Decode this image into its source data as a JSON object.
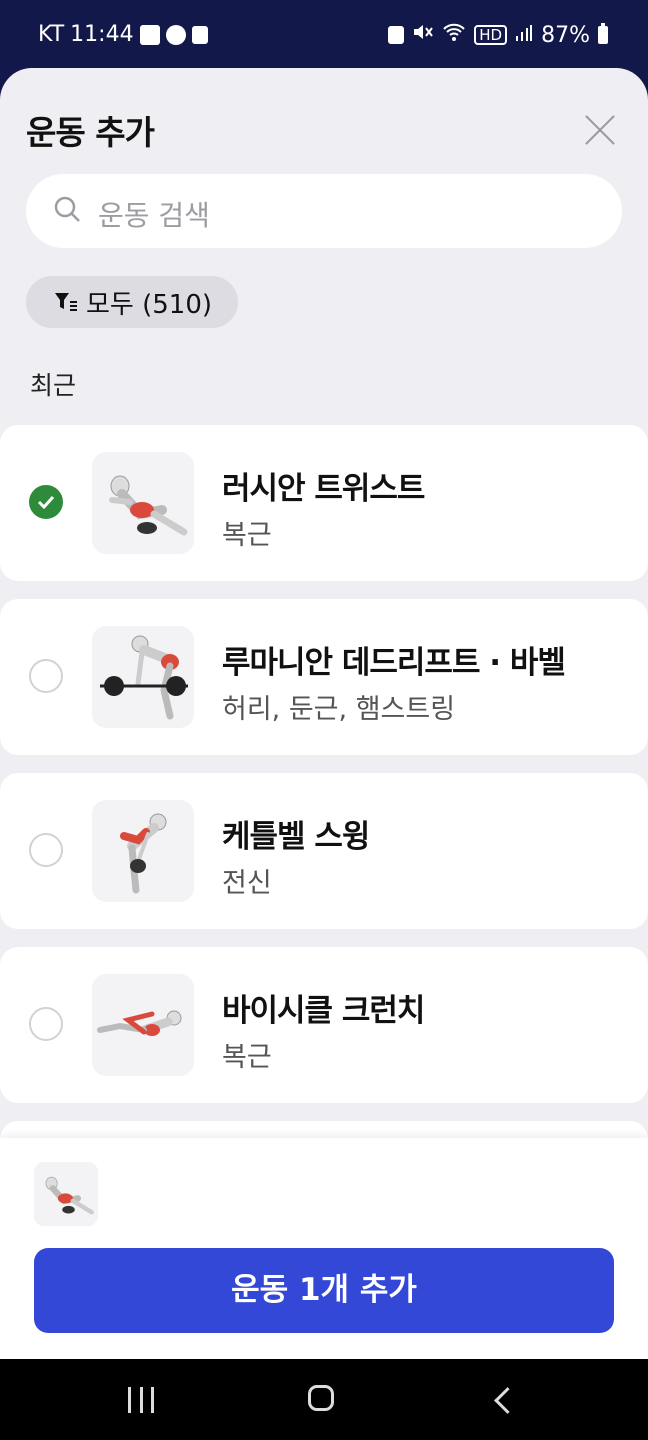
{
  "status_bar": {
    "carrier": "KT",
    "time": "11:44",
    "battery": "87%"
  },
  "sheet": {
    "title": "운동 추가"
  },
  "search": {
    "placeholder": "운동 검색"
  },
  "filter": {
    "label": "모두 (510)"
  },
  "section": {
    "recent_label": "최근"
  },
  "exercises": [
    {
      "name": "러시안 트위스트",
      "muscles": "복근",
      "selected": true
    },
    {
      "name": "루마니안 데드리프트 · 바벨",
      "muscles": "허리, 둔근, 햄스트링",
      "selected": false
    },
    {
      "name": "케틀벨 스윙",
      "muscles": "전신",
      "selected": false
    },
    {
      "name": "바이시클 크런치",
      "muscles": "복근",
      "selected": false
    }
  ],
  "bottom": {
    "add_button_label": "운동 1개 추가"
  },
  "colors": {
    "header_bg": "#13184a",
    "sheet_bg": "#eeeef3",
    "check_green": "#2e8b3a",
    "button_blue": "#3448d8"
  }
}
